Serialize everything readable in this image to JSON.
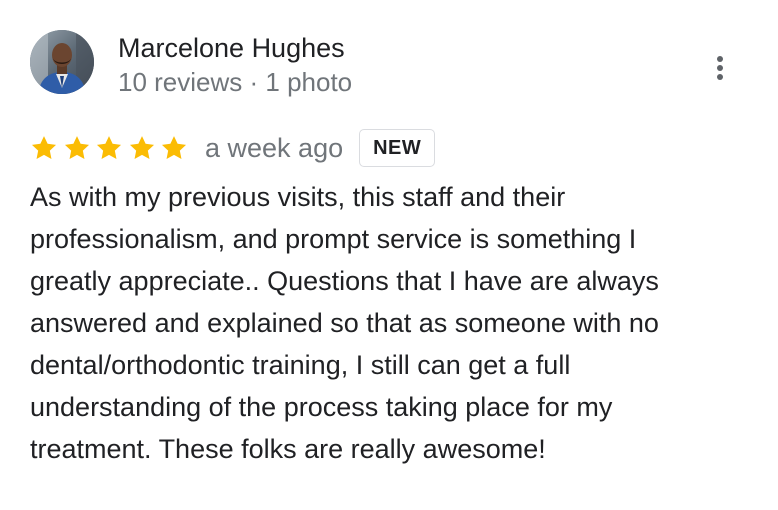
{
  "review": {
    "author": {
      "name": "Marcelone Hughes",
      "meta": "10 reviews · 1 photo",
      "avatar_icon": "user-photo-avatar"
    },
    "rating": {
      "stars": 5,
      "max": 5,
      "star_color": "#fbbc04"
    },
    "time": "a week ago",
    "badge": "NEW",
    "text": "As with my previous visits, this staff and their\nprofessionalism, and prompt service is something I\ngreatly appreciate..  Questions that I have are always\nanswered and explained so that as someone with no\ndental/orthodontic training, I still can get a full\nunderstanding of the process taking place for my\ntreatment. These folks are really awesome!",
    "menu_icon": "more-vert-icon"
  }
}
